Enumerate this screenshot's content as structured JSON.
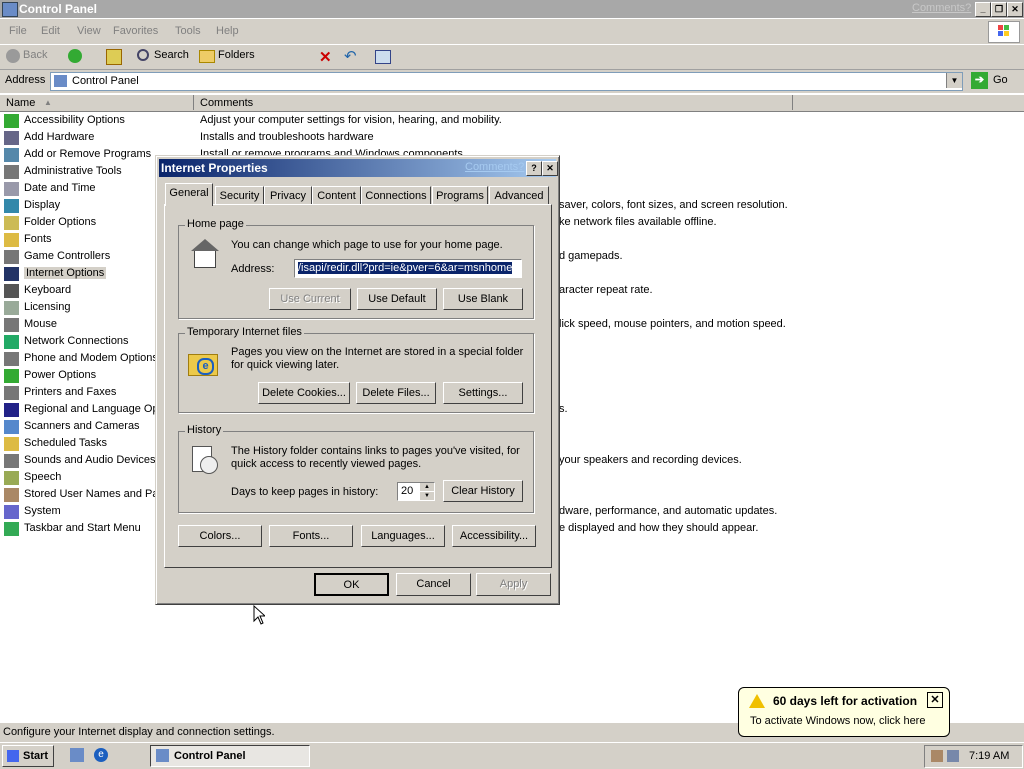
{
  "window": {
    "title": "Control Panel",
    "comments_link": "Comments?"
  },
  "menu": [
    "File",
    "Edit",
    "View",
    "Favorites",
    "Tools",
    "Help"
  ],
  "toolbar": {
    "back": "Back",
    "search": "Search",
    "folders": "Folders"
  },
  "address": {
    "label": "Address",
    "value": "Control Panel",
    "go": "Go"
  },
  "columns": {
    "name": "Name",
    "comments": "Comments"
  },
  "items": [
    {
      "label": "Accessibility Options",
      "comment": "Adjust your computer settings for vision, hearing, and mobility."
    },
    {
      "label": "Add Hardware",
      "comment": "Installs and troubleshoots hardware"
    },
    {
      "label": "Add or Remove Programs",
      "comment": "Install or remove programs and Windows components."
    },
    {
      "label": "Administrative Tools",
      "comment": ""
    },
    {
      "label": "Date and Time",
      "comment": ""
    },
    {
      "label": "Display",
      "comment": "saver, colors, font sizes, and screen resolution."
    },
    {
      "label": "Folder Options",
      "comment": "ke network files available offline."
    },
    {
      "label": "Fonts",
      "comment": ""
    },
    {
      "label": "Game Controllers",
      "comment": "d gamepads."
    },
    {
      "label": "Internet Options",
      "comment": ""
    },
    {
      "label": "Keyboard",
      "comment": "aracter repeat rate."
    },
    {
      "label": "Licensing",
      "comment": ""
    },
    {
      "label": "Mouse",
      "comment": "lick speed, mouse pointers, and motion speed."
    },
    {
      "label": "Network Connections",
      "comment": ""
    },
    {
      "label": "Phone and Modem Options",
      "comment": ""
    },
    {
      "label": "Power Options",
      "comment": ""
    },
    {
      "label": "Printers and Faxes",
      "comment": ""
    },
    {
      "label": "Regional and Language Opt",
      "comment": "s."
    },
    {
      "label": "Scanners and Cameras",
      "comment": ""
    },
    {
      "label": "Scheduled Tasks",
      "comment": ""
    },
    {
      "label": "Sounds and Audio Devices",
      "comment": "your speakers and recording devices."
    },
    {
      "label": "Speech",
      "comment": ""
    },
    {
      "label": "Stored User Names and Pas",
      "comment": ""
    },
    {
      "label": "System",
      "comment": "dware, performance, and automatic updates."
    },
    {
      "label": "Taskbar and Start Menu",
      "comment": "e displayed and how they should appear."
    }
  ],
  "status": "Configure your Internet display and connection settings.",
  "dialog": {
    "title": "Internet Properties",
    "comments": "Comments?",
    "tabs": [
      "General",
      "Security",
      "Privacy",
      "Content",
      "Connections",
      "Programs",
      "Advanced"
    ],
    "home": {
      "group": "Home page",
      "text": "You can change which page to use for your home page.",
      "addr_label": "Address:",
      "addr_value": "/isapi/redir.dll?prd=ie&pver=6&ar=msnhome",
      "use_current": "Use Current",
      "use_default": "Use Default",
      "use_blank": "Use Blank"
    },
    "temp": {
      "group": "Temporary Internet files",
      "text1": "Pages you view on the Internet are stored in a special folder",
      "text2": "for quick viewing later.",
      "delete_cookies": "Delete Cookies...",
      "delete_files": "Delete Files...",
      "settings": "Settings..."
    },
    "history": {
      "group": "History",
      "text1": "The History folder contains links to pages you've visited, for",
      "text2": "quick access to recently viewed pages.",
      "days_label": "Days to keep pages in history:",
      "days_value": "20",
      "clear": "Clear History"
    },
    "bottom": {
      "colors": "Colors...",
      "fonts": "Fonts...",
      "languages": "Languages...",
      "accessibility": "Accessibility..."
    },
    "ok": "OK",
    "cancel": "Cancel",
    "apply": "Apply"
  },
  "balloon": {
    "title": "60 days left for activation",
    "text": "To activate Windows now, click here"
  },
  "taskbar": {
    "start": "Start",
    "task": "Control Panel",
    "clock": "7:19 AM"
  },
  "colors": {
    "titlebar_active": "#0a246a",
    "face": "#d4d0c8"
  }
}
